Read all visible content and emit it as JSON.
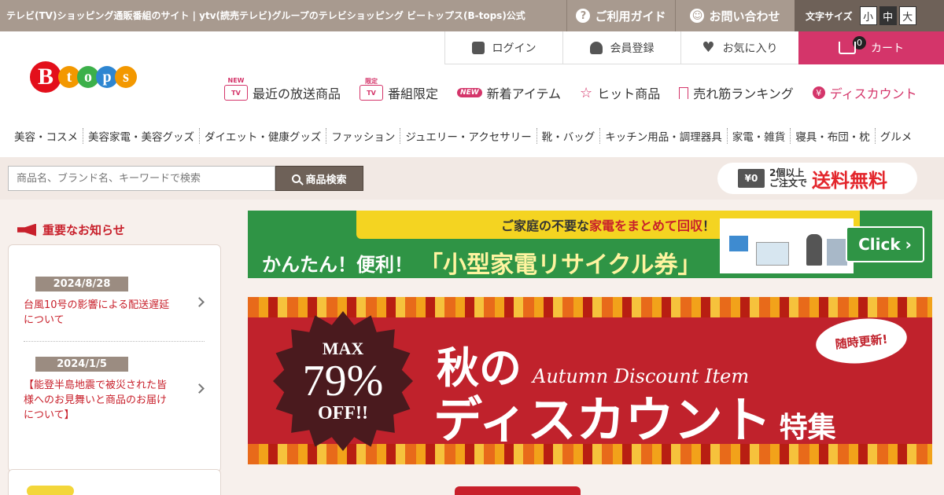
{
  "topbar": {
    "tagline": "テレビ(TV)ショッピング通販番組のサイト | ytv(読売テレビ)グループのテレビショッピング ビートップス(B-tops)公式",
    "guide": "ご利用ガイド",
    "contact": "お問い合わせ",
    "font_size_label": "文字サイズ",
    "font_sizes": [
      "小",
      "中",
      "大"
    ],
    "font_size_selected": "中"
  },
  "account": {
    "login": "ログイン",
    "register": "会員登録",
    "favorites": "お気に入り",
    "cart": "カート",
    "cart_count": "0"
  },
  "logo": {
    "letters": [
      "B",
      "t",
      "o",
      "p",
      "s"
    ]
  },
  "nav": {
    "recent": {
      "label": "最近の放送商品",
      "icon_tag": "NEW",
      "icon_text": "TV"
    },
    "limited": {
      "label": "番組限定",
      "icon_tag": "限定",
      "icon_text": "TV"
    },
    "new_items": {
      "label": "新着アイテム",
      "pill": "NEW"
    },
    "hits": {
      "label": "ヒット商品"
    },
    "ranking": {
      "label": "売れ筋ランキング"
    },
    "discount": {
      "label": "ディスカウント"
    }
  },
  "categories": [
    "美容・コスメ",
    "美容家電・美容グッズ",
    "ダイエット・健康グッズ",
    "ファッション",
    "ジュエリー・アクセサリー",
    "靴・バッグ",
    "キッチン用品・調理器具",
    "家電・雑貨",
    "寝具・布団・枕",
    "グルメ"
  ],
  "search": {
    "placeholder": "商品名、ブランド名、キーワードで検索",
    "button": "商品検索"
  },
  "shipping": {
    "icon_text": "¥0",
    "line1": "2個以上",
    "line2": "ご注文で",
    "main": "送料無料"
  },
  "notices": {
    "heading": "重要なお知らせ",
    "items": [
      {
        "date": "2024/8/28",
        "text": "台風10号の影響による配送遅延について"
      },
      {
        "date": "2024/1/5",
        "text": "【能登半島地震で被災された皆様へのお見舞いと商品のお届けについて】"
      }
    ]
  },
  "banner_recycle": {
    "top": "ご家庭の不要な家電をまとめて回収！",
    "top_highlight": "家電をまとめて回収",
    "main1": "かんたん！便利！",
    "main2": "「小型家電リサイクル券」",
    "cta": "Click"
  },
  "banner_autumn": {
    "max": "MAX",
    "percent": "79%",
    "off": "OFF!!",
    "title1": "秋の",
    "script": "Autumn Discount Item",
    "title2": "ディスカウント",
    "title3": "特集",
    "bubble": "随時更新!"
  },
  "colors": {
    "brand_pink": "#d4356a",
    "topbar": "#a89a8f",
    "notice_red": "#c8202b",
    "recycle_green": "#2f9445",
    "autumn_red": "#c0222c",
    "logo_colors": [
      "#e30f1b",
      "#f39800",
      "#3cb04a",
      "#2e86d1",
      "#f39800"
    ]
  }
}
